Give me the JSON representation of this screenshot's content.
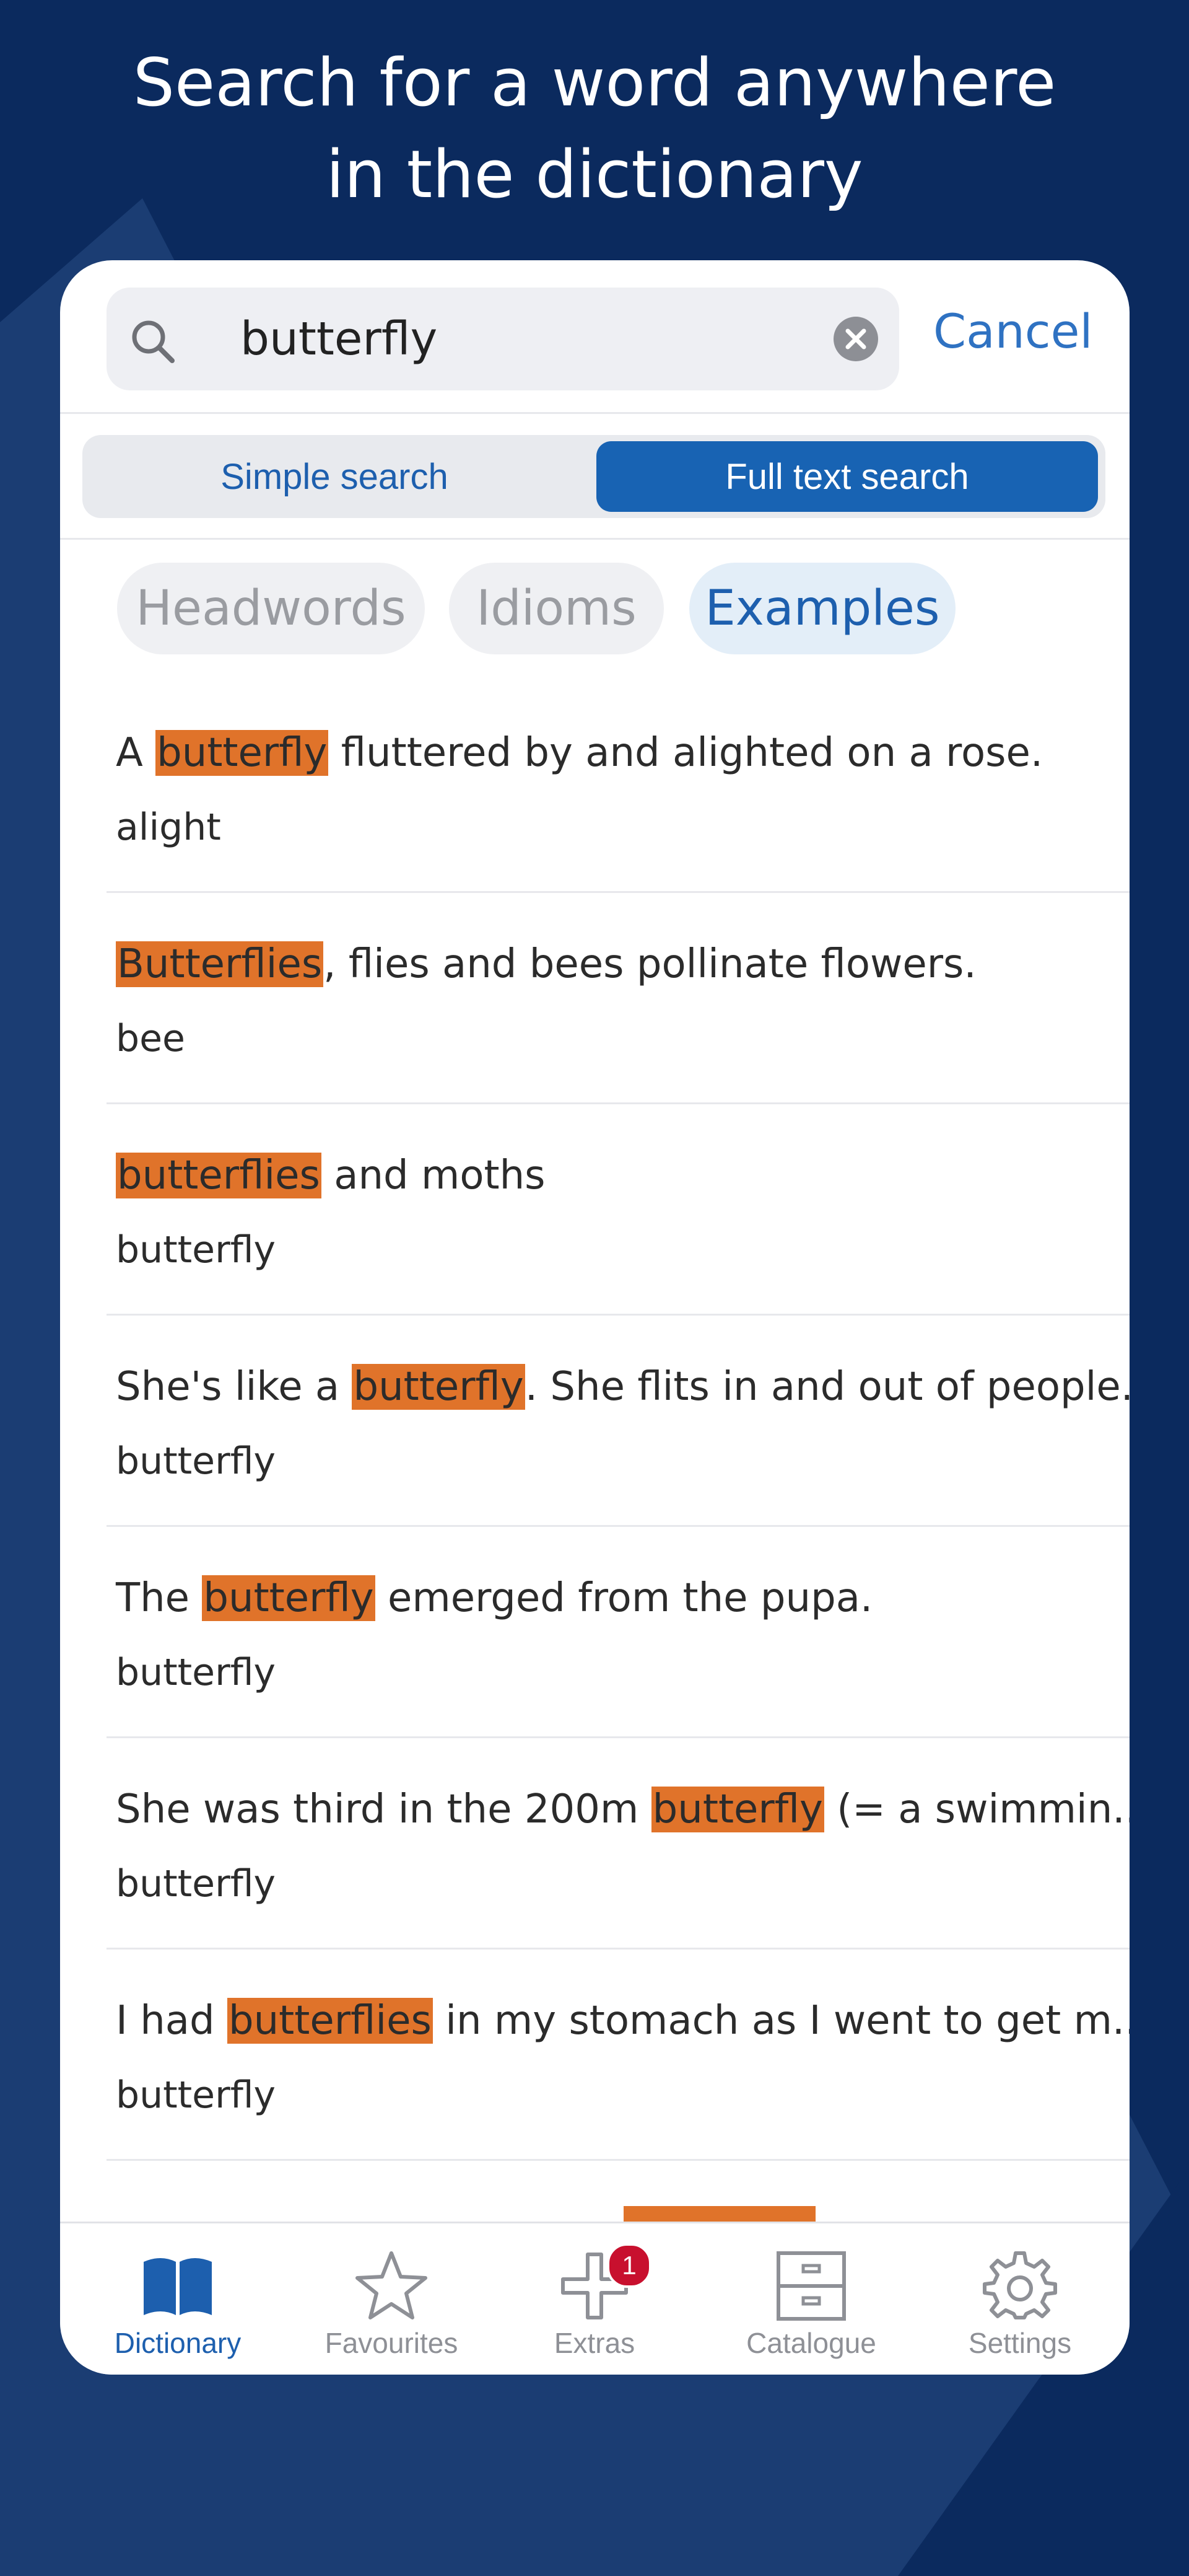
{
  "promo": {
    "line1": "Search for a word anywhere",
    "line2": "in the dictionary"
  },
  "search": {
    "value": "butterfly",
    "cancel_label": "Cancel"
  },
  "segment": {
    "simple_label": "Simple search",
    "full_label": "Full text search",
    "selected": "Full text search"
  },
  "filters": {
    "headwords": "Headwords",
    "idioms": "Idioms",
    "examples": "Examples",
    "selected": "Examples"
  },
  "results": [
    {
      "pre": "A ",
      "hl": "butterfly",
      "post": " fluttered by and alighted on a rose.",
      "word": "alight"
    },
    {
      "pre": "",
      "hl": "Butterflies",
      "post": ", flies and bees pollinate flowers.",
      "word": "bee"
    },
    {
      "pre": "",
      "hl": "butterflies",
      "post": " and moths",
      "word": "butterfly"
    },
    {
      "pre": "She's like a ",
      "hl": "butterfly",
      "post": ". She flits in and out of people...",
      "word": "butterfly"
    },
    {
      "pre": "The ",
      "hl": "butterfly",
      "post": " emerged from the pupa.",
      "word": "butterfly"
    },
    {
      "pre": "She was third in the 200m ",
      "hl": "butterfly",
      "post": " (= a swimmin...",
      "word": "butterfly"
    },
    {
      "pre": "I had ",
      "hl": "butterflies",
      "post": " in my stomach as I went to get m...",
      "word": "butterfly"
    }
  ],
  "tabs": {
    "dictionary": "Dictionary",
    "favourites": "Favourites",
    "extras": "Extras",
    "extras_badge": "1",
    "catalogue": "Catalogue",
    "settings": "Settings"
  },
  "colors": {
    "background": "#0b2a5e",
    "accent": "#1d5fae",
    "highlight": "#e0732a",
    "badge": "#c8102e"
  }
}
